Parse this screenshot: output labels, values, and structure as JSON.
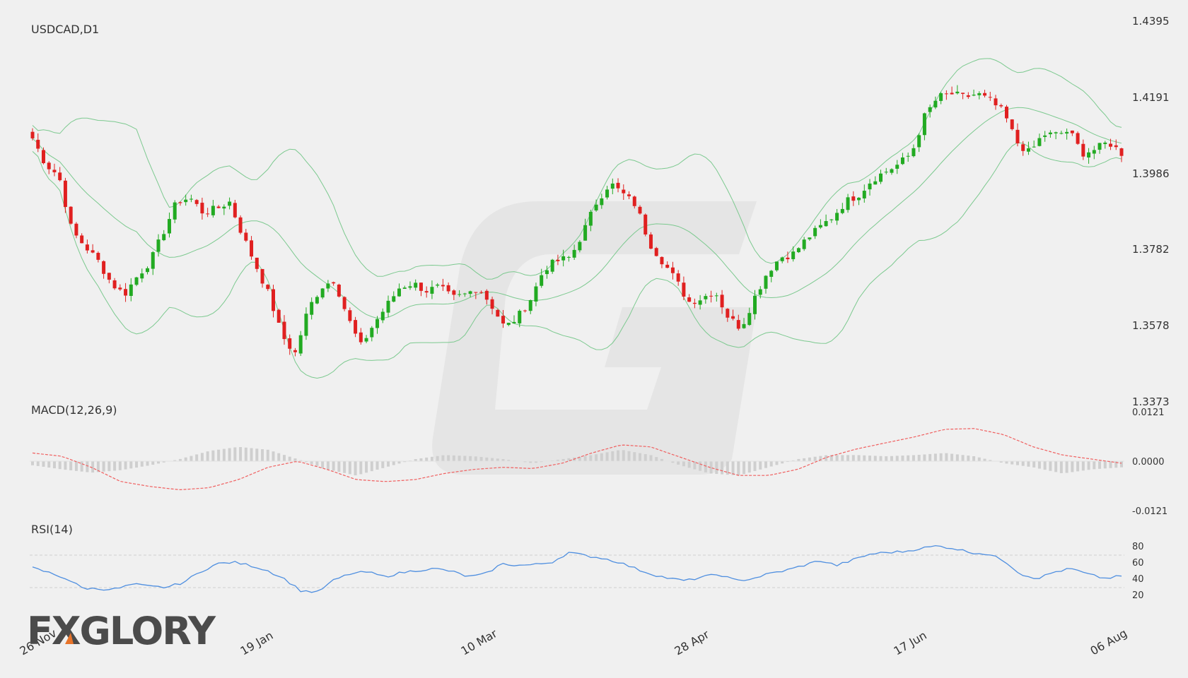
{
  "chart_data": [
    {
      "type": "candlestick",
      "title": "USDCAD,D1",
      "y_ticks": [
        "1.4395",
        "1.4191",
        "1.3986",
        "1.3782",
        "1.3578",
        "1.3373"
      ],
      "ylim": [
        1.3373,
        1.4395
      ],
      "x_ticks": [
        "26 Nov",
        "19 Jan",
        "10 Mar",
        "28 Apr",
        "17 Jun",
        "06 Aug"
      ],
      "overlays": [
        "Bollinger Bands (upper, middle, lower)"
      ],
      "ohlc_anchors_close": [
        1.408,
        1.401,
        1.398,
        1.383,
        1.379,
        1.375,
        1.369,
        1.366,
        1.371,
        1.375,
        1.383,
        1.391,
        1.392,
        1.388,
        1.389,
        1.391,
        1.382,
        1.374,
        1.366,
        1.355,
        1.35,
        1.362,
        1.368,
        1.37,
        1.36,
        1.352,
        1.358,
        1.363,
        1.368,
        1.369,
        1.367,
        1.368,
        1.365,
        1.366,
        1.368,
        1.363,
        1.357,
        1.36,
        1.365,
        1.373,
        1.375,
        1.376,
        1.383,
        1.391,
        1.396,
        1.393,
        1.39,
        1.38,
        1.375,
        1.37,
        1.364,
        1.365,
        1.367,
        1.36,
        1.357,
        1.365,
        1.372,
        1.376,
        1.377,
        1.381,
        1.384,
        1.387,
        1.391,
        1.393,
        1.397,
        1.399,
        1.401,
        1.404,
        1.414,
        1.419,
        1.42,
        1.419,
        1.42,
        1.418,
        1.415,
        1.407,
        1.404,
        1.409,
        1.409,
        1.41,
        1.404,
        1.405,
        1.407,
        1.404
      ]
    },
    {
      "type": "line+histogram",
      "title": "MACD(12,26,9)",
      "y_ticks": [
        "0.0121",
        "0.0000",
        "-0.0121"
      ],
      "ylim": [
        -0.0121,
        0.0121
      ],
      "signal_anchors": [
        0.002,
        0.0012,
        -0.0015,
        -0.005,
        -0.0062,
        -0.007,
        -0.0065,
        -0.0045,
        -0.0015,
        0.0,
        -0.002,
        -0.0045,
        -0.005,
        -0.0045,
        -0.003,
        -0.002,
        -0.0015,
        -0.0018,
        -0.0005,
        0.002,
        0.004,
        0.0035,
        0.001,
        -0.0015,
        -0.0035,
        -0.0035,
        -0.002,
        0.001,
        0.003,
        0.0045,
        0.006,
        0.0078,
        0.008,
        0.0065,
        0.0035,
        0.0015,
        0.0005,
        -0.0005
      ],
      "histogram_anchors": [
        -0.001,
        -0.002,
        -0.0028,
        -0.0022,
        -0.001,
        0.0005,
        0.0025,
        0.0035,
        0.0028,
        0.0005,
        -0.002,
        -0.0035,
        -0.0015,
        0.0005,
        0.0015,
        0.0012,
        0.0005,
        -0.0005,
        0.0005,
        0.0015,
        0.0028,
        0.0015,
        -0.001,
        -0.003,
        -0.0035,
        -0.0015,
        0.0005,
        0.0015,
        0.0015,
        0.0012,
        0.0015,
        0.002,
        0.0012,
        -0.0005,
        -0.0015,
        -0.003,
        -0.002,
        -0.0015
      ]
    },
    {
      "type": "line",
      "title": "RSI(14)",
      "y_ticks": [
        "80",
        "60",
        "40",
        "20"
      ],
      "ylim": [
        20,
        80
      ],
      "reference_lines": [
        30,
        70
      ],
      "values_anchors": [
        53,
        47,
        40,
        28,
        27,
        27,
        33,
        30,
        29,
        35,
        48,
        58,
        60,
        56,
        50,
        40,
        25,
        23,
        38,
        46,
        48,
        42,
        47,
        50,
        52,
        49,
        42,
        45,
        58,
        56,
        57,
        60,
        72,
        68,
        65,
        60,
        52,
        45,
        40,
        37,
        42,
        45,
        37,
        40,
        46,
        50,
        56,
        62,
        56,
        63,
        70,
        72,
        73,
        77,
        80,
        77,
        72,
        70,
        62,
        45,
        40,
        48,
        52,
        45,
        40,
        43
      ]
    }
  ],
  "colors": {
    "bull": "#22aa22",
    "bear": "#e02020",
    "bands": "#7cc98f",
    "macd_hist": "#cfcfcf",
    "macd_signal": "#f06060",
    "rsi": "#4f8fe0",
    "grid": "#d6d6d6"
  },
  "watermark": {
    "logo_text": "FXGLORY"
  }
}
